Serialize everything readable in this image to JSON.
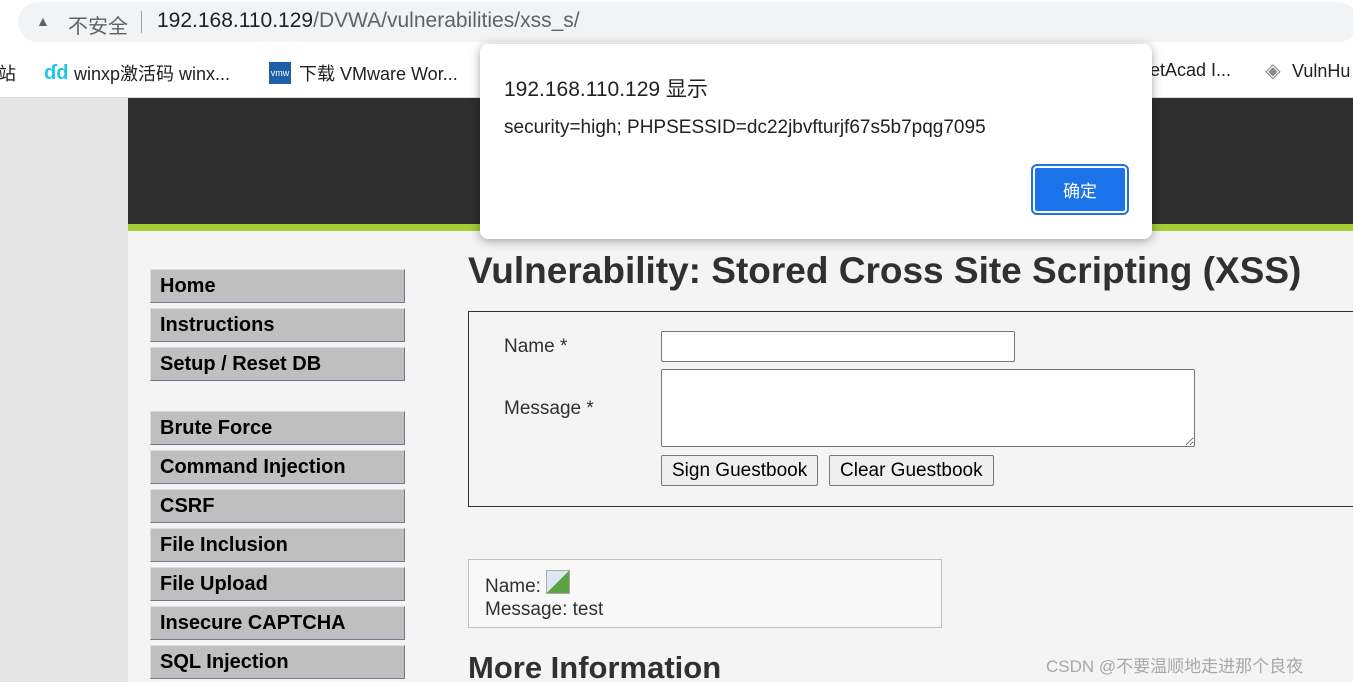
{
  "browser": {
    "security_label": "不安全",
    "url_host": "192.168.110.129",
    "url_path": "/DVWA/vulnerabilities/xss_s/",
    "bookmarks": [
      {
        "label": "站",
        "icon": "site-icon"
      },
      {
        "label": "winxp激活码 winx...",
        "icon": "dd-icon"
      },
      {
        "label": "下载 VMware Wor...",
        "icon": "vmw-icon"
      },
      {
        "label": "etAcad I...",
        "icon": ""
      },
      {
        "label": "VulnHu",
        "icon": "vulnhub-icon"
      }
    ],
    "vmw_icon_text": "vmw"
  },
  "sidebar": {
    "items": [
      "Home",
      "Instructions",
      "Setup / Reset DB",
      "Brute Force",
      "Command Injection",
      "CSRF",
      "File Inclusion",
      "File Upload",
      "Insecure CAPTCHA",
      "SQL Injection"
    ]
  },
  "main": {
    "title": "Vulnerability: Stored Cross Site Scripting (XSS)",
    "form": {
      "name_label": "Name *",
      "name_value": "",
      "message_label": "Message *",
      "message_value": "",
      "sign_button": "Sign Guestbook",
      "clear_button": "Clear Guestbook"
    },
    "entry": {
      "name_label": "Name:",
      "message_text": "Message: test"
    },
    "more_info": "More Information"
  },
  "dialog": {
    "title": "192.168.110.129 显示",
    "message": "security=high; PHPSESSID=dc22jbvfturjf67s5b7pqg7095",
    "ok_button": "确定",
    "accent": "#1a73e8"
  },
  "watermark": "CSDN @不要温顺地走进那个良夜"
}
